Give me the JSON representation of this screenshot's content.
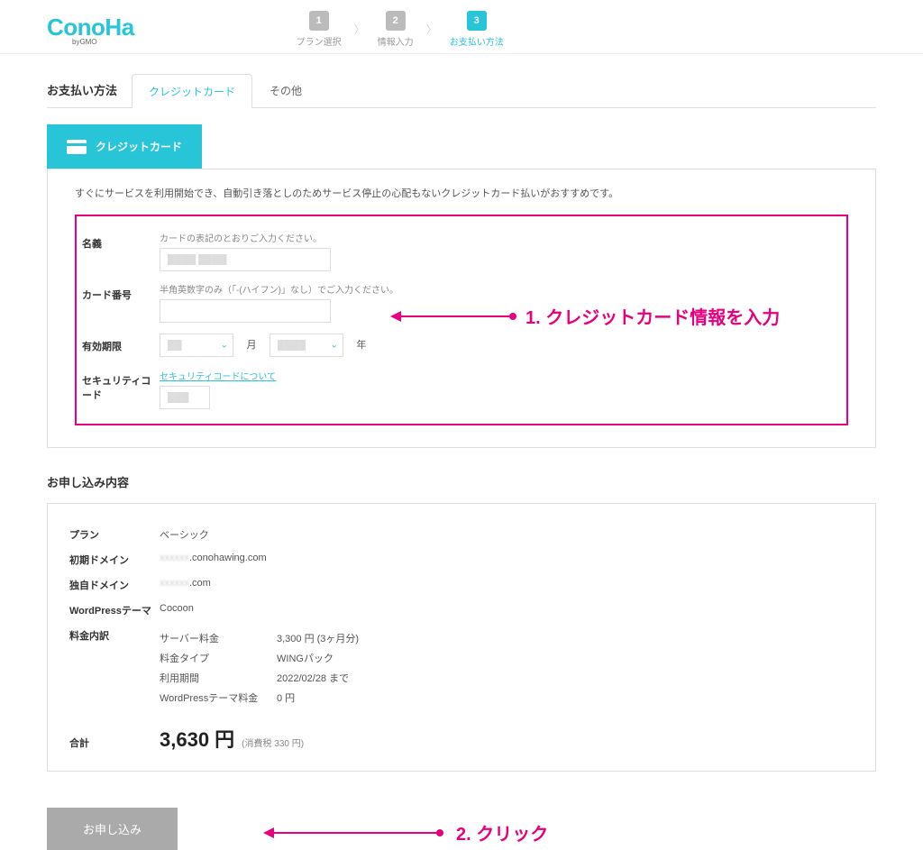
{
  "logo": {
    "text": "ConoHa",
    "sub": "byGMO"
  },
  "stepper": [
    {
      "num": "1",
      "label": "プラン選択"
    },
    {
      "num": "2",
      "label": "情報入力"
    },
    {
      "num": "3",
      "label": "お支払い方法"
    }
  ],
  "tabs": {
    "title": "お支払い方法",
    "active": "クレジットカード",
    "other": "その他"
  },
  "cc_button": "クレジットカード",
  "panel_note": "すぐにサービスを利用開始でき、自動引き落としのためサービス停止の心配もないクレジットカード払いがおすすめです。",
  "form": {
    "name_label": "名義",
    "name_hint": "カードの表記のとおりご入力ください。",
    "name_value": "",
    "card_label": "カード番号",
    "card_hint": "半角英数字のみ（「-(ハイフン)」なし）でご入力ください。",
    "expiry_label": "有効期限",
    "month_unit": "月",
    "year_unit": "年",
    "cvv_label": "セキュリティコード",
    "cvv_link": "セキュリティコードについて"
  },
  "annot1": "1. クレジットカード情報を入力",
  "section_title": "お申し込み内容",
  "summary": {
    "plan_label": "プラン",
    "plan_value": "ベーシック",
    "initdomain_label": "初期ドメイン",
    "initdomain_blur": "xxxxxx",
    "initdomain_value": ".conohawing.com",
    "owndomain_label": "独自ドメイン",
    "owndomain_blur": "xxxxxx",
    "owndomain_value": ".com",
    "wp_label": "WordPressテーマ",
    "wp_value": "Cocoon",
    "fee_label": "料金内訳",
    "breakdown": [
      {
        "label": "サーバー料金",
        "value": "3,300 円 (3ヶ月分)"
      },
      {
        "label": "料金タイプ",
        "value": "WINGパック"
      },
      {
        "label": "利用期間",
        "value": "2022/02/28 まで"
      },
      {
        "label": "WordPressテーマ料金",
        "value": "0 円"
      }
    ],
    "total_label": "合計",
    "total_value": "3,630 円",
    "total_tax": "(消費税 330 円)"
  },
  "submit": "お申し込み",
  "annot2": "2. クリック"
}
